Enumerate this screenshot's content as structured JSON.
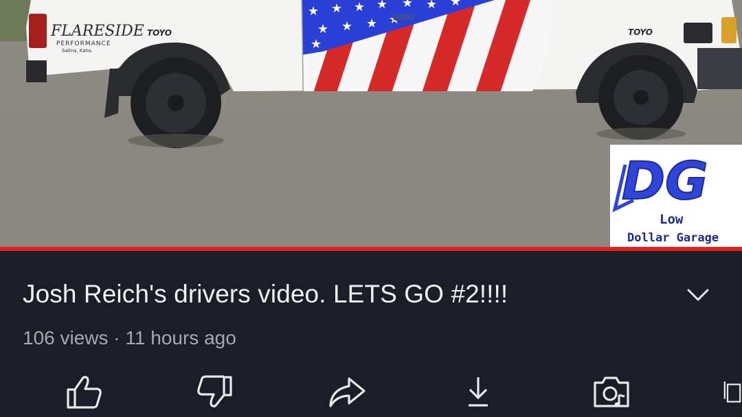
{
  "video": {
    "title": "Josh Reich's drivers video. LETS GO #2!!!!",
    "views": "106 views",
    "separator": " · ",
    "age": "11 hours ago",
    "progress_fraction": 1.0,
    "truck_decals": {
      "brand": "FLARESIDE",
      "brand_sub": "PERFORMANCE",
      "brand_city": "Salina, Kans.",
      "tire_brand_left": "TOYO",
      "tire_brand_right": "TOYO"
    },
    "channel_logo": {
      "initials": "DG",
      "line1": "Low",
      "line2": "Dollar Garage"
    }
  },
  "actions": [
    {
      "id": "like",
      "icon": "thumbs-up-icon"
    },
    {
      "id": "dislike",
      "icon": "thumbs-down-icon"
    },
    {
      "id": "share",
      "icon": "share-icon"
    },
    {
      "id": "download",
      "icon": "download-icon"
    },
    {
      "id": "remix",
      "icon": "remix-camera-icon"
    },
    {
      "id": "save",
      "icon": "save-icon"
    }
  ],
  "colors": {
    "background": "#1b1d28",
    "progress": "#e0201a",
    "title_text": "#f2f2f2",
    "meta_text": "#a9a9ad"
  }
}
